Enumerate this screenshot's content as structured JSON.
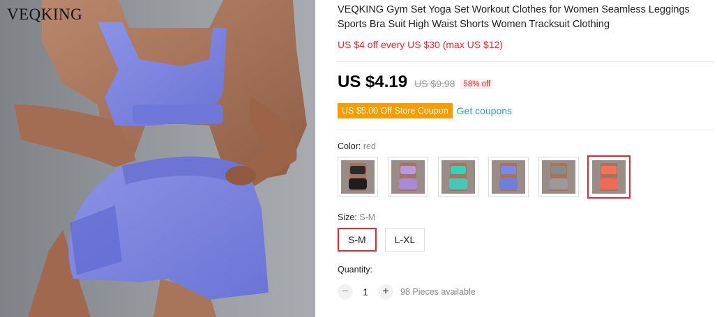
{
  "image": {
    "brand": "VEQKING"
  },
  "product": {
    "title": "VEQKING Gym Set Yoga Set Workout Clothes for Women Seamless Leggings Sports Bra Suit High Waist Shorts Women Tracksuit Clothing",
    "promo": "US $4 off every US $30 (max US $12)",
    "price": "US $4.19",
    "old_price": "US $9.98",
    "discount": "58% off",
    "coupon_badge": "US $5.00 Off Store Coupon",
    "coupon_link": "Get coupons"
  },
  "color": {
    "label": "Color:",
    "selected": "red",
    "options": [
      {
        "name": "black",
        "top": "#2a2a2a",
        "bottom": "#1e1e1e"
      },
      {
        "name": "purple",
        "top": "#b69ae0",
        "bottom": "#a98ad8"
      },
      {
        "name": "teal",
        "top": "#3ad0b8",
        "bottom": "#45c9b5"
      },
      {
        "name": "blue",
        "top": "#7a88e6",
        "bottom": "#6f7fe0"
      },
      {
        "name": "grey",
        "top": "#8a8a8a",
        "bottom": "#9a9a9a"
      },
      {
        "name": "red",
        "top": "#f2735c",
        "bottom": "#f16a57"
      }
    ]
  },
  "size": {
    "label": "Size:",
    "selected": "S-M",
    "options": [
      "S-M",
      "L-XL"
    ]
  },
  "quantity": {
    "label": "Quantity:",
    "minus": "−",
    "value": "1",
    "plus": "+",
    "available": "98 Pieces available"
  },
  "colors": {
    "accent": "#f5222d",
    "coupon": "#fa9b00",
    "link": "#2e9cc3"
  }
}
